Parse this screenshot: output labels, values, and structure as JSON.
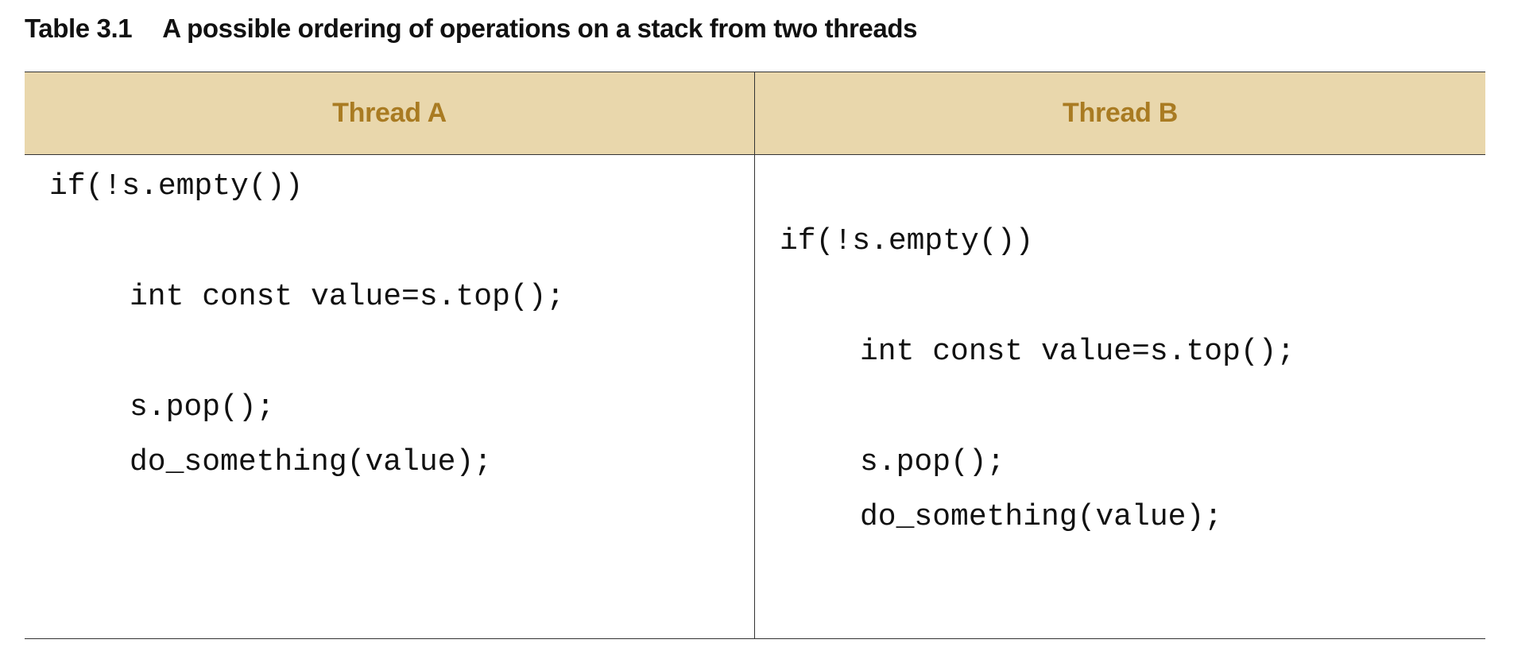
{
  "caption": {
    "number": "Table 3.1",
    "title": "A possible ordering of operations on a stack from two threads"
  },
  "table": {
    "headers": [
      "Thread A",
      "Thread B"
    ],
    "rows": [
      {
        "thread_a": "if(!s.empty())",
        "thread_b": ""
      },
      {
        "thread_a": "",
        "thread_b": "if(!s.empty())"
      },
      {
        "thread_a": "int const value=s.top();",
        "thread_b": ""
      },
      {
        "thread_a": "",
        "thread_b": "int const value=s.top();"
      },
      {
        "thread_a": "s.pop();",
        "thread_b": ""
      },
      {
        "thread_a": "do_something(value);",
        "thread_b": "s.pop();"
      },
      {
        "thread_a": "",
        "thread_b": "do_something(value);"
      }
    ]
  },
  "colors": {
    "header_background": "#e9d7ac",
    "header_text": "#a97b22",
    "rule": "#333333"
  }
}
